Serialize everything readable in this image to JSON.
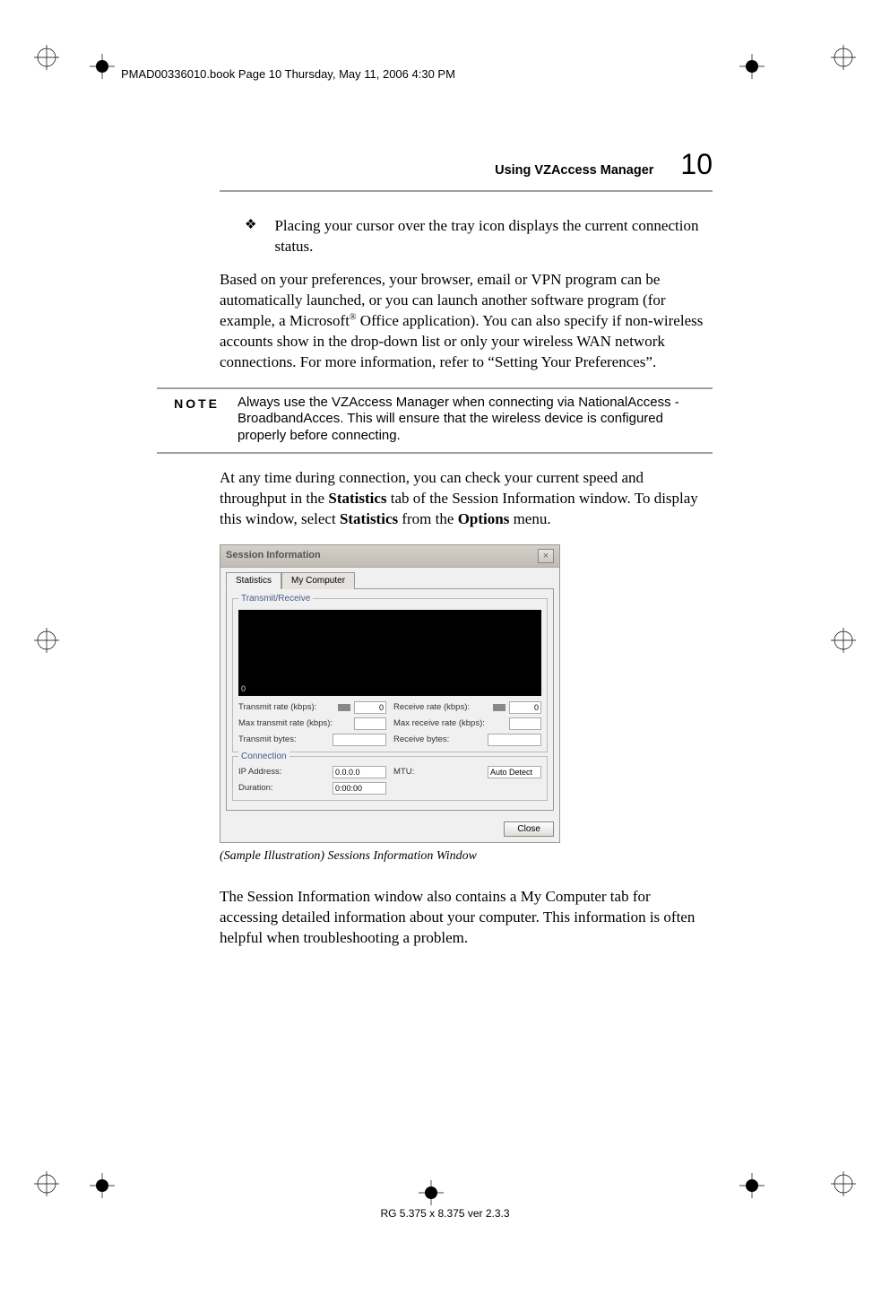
{
  "header_line": "PMAD00336010.book  Page 10  Thursday, May 11, 2006  4:30 PM",
  "running_header": {
    "title": "Using VZAccess Manager",
    "page_number": "10"
  },
  "bullet": {
    "symbol": "❖",
    "text": "Placing your cursor over the tray icon displays the current connection status."
  },
  "para1_part1": "Based on your preferences, your browser, email or VPN program can be automatically launched, or you can launch another software program (for example, a Microsoft",
  "para1_sup": "®",
  "para1_part2": " Office application). You can also specify if non-wireless accounts show in the drop-down list or only your wireless WAN network connections. For more information, refer to “Setting Your Preferences”.",
  "note": {
    "label": "NOTE",
    "text": "Always use the VZAccess Manager when connecting via NationalAccess - BroadbandAcces. This will ensure that the wireless device is configured properly before connecting."
  },
  "para2_part1": "At any time during connection, you can check your current speed and throughput in the ",
  "para2_bold1": "Statistics",
  "para2_part2": " tab of the Session Information window. To display this window, select ",
  "para2_bold2": "Statistics",
  "para2_part3": " from the ",
  "para2_bold3": "Options",
  "para2_part4": " menu.",
  "session_window": {
    "title": "Session Information",
    "close_x": "×",
    "tabs": {
      "statistics": "Statistics",
      "mycomputer": "My Computer"
    },
    "group_tx": "Transmit/Receive",
    "graph_zero": "0",
    "tx_rate_label": "Transmit rate (kbps):",
    "tx_rate_val": "0",
    "rx_rate_label": "Receive rate (kbps):",
    "rx_rate_val": "0",
    "max_tx_label": "Max transmit rate (kbps):",
    "max_tx_val": "",
    "max_rx_label": "Max receive rate (kbps):",
    "max_rx_val": "",
    "tx_bytes_label": "Transmit bytes:",
    "tx_bytes_val": "",
    "rx_bytes_label": "Receive bytes:",
    "rx_bytes_val": "",
    "group_conn": "Connection",
    "ip_label": "IP Address:",
    "ip_val": "0.0.0.0",
    "mtu_label": "MTU:",
    "mtu_val": "Auto Detect",
    "duration_label": "Duration:",
    "duration_val": "0:00:00",
    "close_btn": "Close"
  },
  "caption": "(Sample Illustration) Sessions Information Window",
  "para3": "The Session Information window also contains a My Computer tab for accessing detailed information about your computer. This information is often helpful when troubleshooting a problem.",
  "footer": "RG 5.375 x 8.375 ver 2.3.3"
}
